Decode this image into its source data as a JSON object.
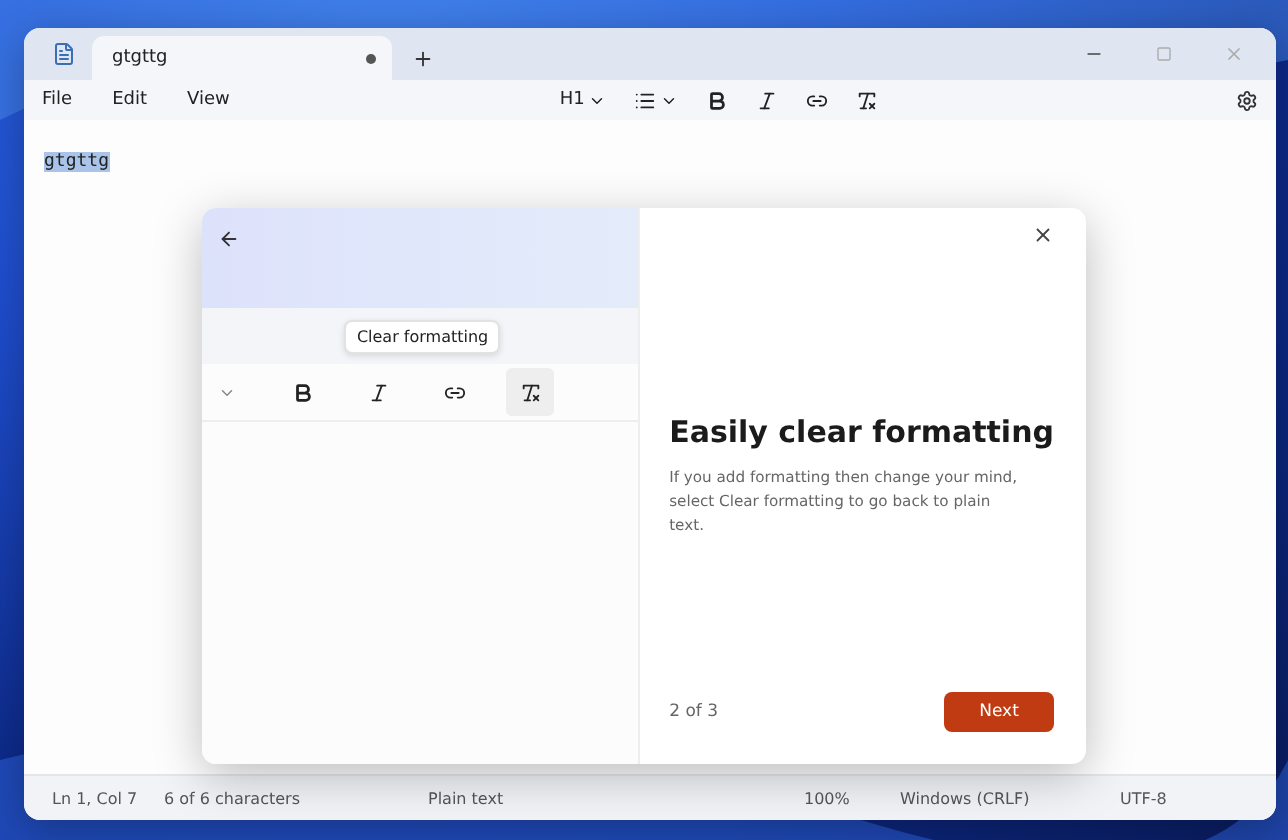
{
  "tab": {
    "title": "gtgttg",
    "unsaved": true
  },
  "menu": [
    "File",
    "Edit",
    "View"
  ],
  "toolbar": {
    "heading": "H1"
  },
  "document": {
    "text": "gtgttg",
    "selected": true
  },
  "dialog": {
    "preview": {
      "tooltip": "Clear formatting"
    },
    "title": "Easily clear formatting",
    "body": "If you add formatting then change your mind, select Clear formatting to go back to plain text.",
    "progress": "2 of 3",
    "next": "Next"
  },
  "status_bar": [
    "Ln 1, Col 7",
    "6 of 6 characters",
    "Plain text",
    "100%",
    "Windows (CRLF)",
    "UTF-8"
  ]
}
